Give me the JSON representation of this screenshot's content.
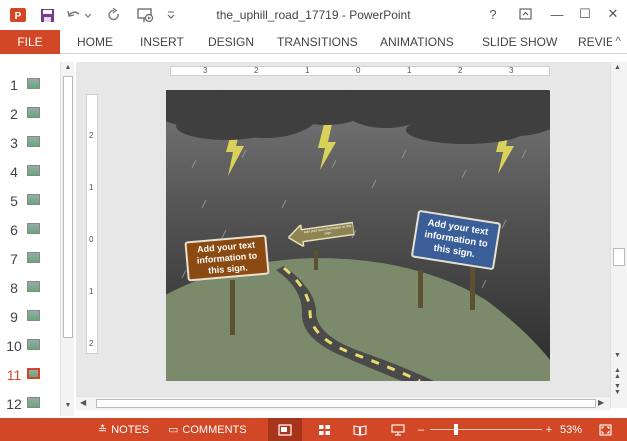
{
  "window": {
    "title": "the_uphill_road_17719 - PowerPoint",
    "help_label": "?",
    "minimize_label": "—",
    "maximize_label": "☐",
    "close_label": "✕"
  },
  "quick_access": {
    "app_icon": "powerpoint-logo-icon",
    "save_icon": "save-icon",
    "undo_icon": "undo-icon",
    "redo_icon": "redo-icon",
    "start_icon": "start-from-beginning-icon",
    "more_icon": "customize-icon"
  },
  "ribbon": {
    "file_label": "FILE",
    "tabs": [
      "HOME",
      "INSERT",
      "DESIGN",
      "TRANSITIONS",
      "ANIMATIONS",
      "SLIDE SHOW",
      "REVIEW"
    ],
    "collapse_label": "^"
  },
  "thumbnails": {
    "numbers": [
      "1",
      "2",
      "3",
      "4",
      "5",
      "6",
      "7",
      "8",
      "9",
      "10",
      "11",
      "12"
    ],
    "active_index": 10
  },
  "rulers": {
    "horizontal": [
      "3",
      "2",
      "1",
      "0",
      "1",
      "2",
      "3"
    ],
    "vertical": [
      "2",
      "1",
      "0",
      "1",
      "2"
    ]
  },
  "slide": {
    "sign_left": "Add your text information to this sign.",
    "sign_right": "Add your text information to this sign.",
    "arrow_sign": "Add your text information to this sign."
  },
  "status": {
    "notes_label": "NOTES",
    "comments_label": "COMMENTS",
    "zoom_minus": "–",
    "zoom_plus": "+",
    "zoom_value": "53%"
  },
  "colors": {
    "accent": "#d24726",
    "sign_brown": "#8b4a12",
    "sign_blue": "#3a5f98",
    "ground": "#7c8a6c",
    "road": "#4a4a4a",
    "road_dash": "#e8dc6a"
  }
}
